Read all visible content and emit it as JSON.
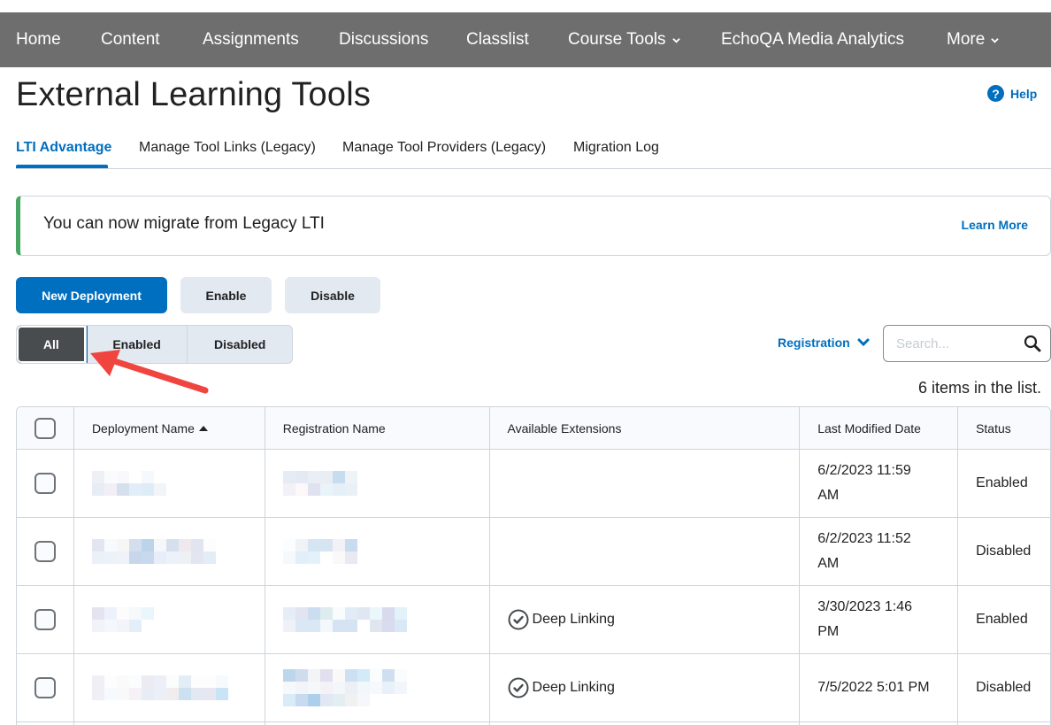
{
  "nav": {
    "items": [
      {
        "label": "Home",
        "dropdown": false
      },
      {
        "label": "Content",
        "dropdown": false
      },
      {
        "label": "Assignments",
        "dropdown": false
      },
      {
        "label": "Discussions",
        "dropdown": false
      },
      {
        "label": "Classlist",
        "dropdown": false
      },
      {
        "label": "Course Tools",
        "dropdown": true
      },
      {
        "label": "EchoQA Media Analytics",
        "dropdown": false
      },
      {
        "label": "More",
        "dropdown": true
      }
    ]
  },
  "page": {
    "title": "External Learning Tools",
    "help_label": "Help",
    "help_icon": "?"
  },
  "tabs": [
    {
      "label": "LTI Advantage",
      "active": true
    },
    {
      "label": "Manage Tool Links (Legacy)",
      "active": false
    },
    {
      "label": "Manage Tool Providers (Legacy)",
      "active": false
    },
    {
      "label": "Migration Log",
      "active": false
    }
  ],
  "alert": {
    "message": "You can now migrate from Legacy LTI",
    "link": "Learn More",
    "accent_color": "#46a661"
  },
  "actions": {
    "new_deployment": "New Deployment",
    "enable": "Enable",
    "disable": "Disable"
  },
  "filter": {
    "options": [
      "All",
      "Enabled",
      "Disabled"
    ],
    "selected": "All"
  },
  "registration_dropdown": "Registration",
  "search": {
    "placeholder": "Search...",
    "value": ""
  },
  "item_count": "6 items in the list.",
  "table": {
    "headers": {
      "deployment_name": "Deployment Name",
      "registration_name": "Registration Name",
      "available_extensions": "Available Extensions",
      "last_modified": "Last Modified Date",
      "status": "Status"
    },
    "sort": {
      "column": "deployment_name",
      "direction": "ascending"
    },
    "rows": [
      {
        "deployment_name": "[redacted]",
        "registration_name": "[redacted]",
        "extension": "",
        "last_modified": "6/2/2023 11:59\nAM",
        "status": "Enabled"
      },
      {
        "deployment_name": "[redacted]",
        "registration_name": "[redacted]",
        "extension": "",
        "last_modified": "6/2/2023 11:52\nAM",
        "status": "Disabled"
      },
      {
        "deployment_name": "[redacted]",
        "registration_name": "[redacted]",
        "extension": "Deep Linking",
        "last_modified": "3/30/2023 1:46\nPM",
        "status": "Enabled"
      },
      {
        "deployment_name": "[redacted]",
        "registration_name": "[redacted]",
        "extension": "Deep Linking",
        "last_modified": "7/5/2022 5:01 PM",
        "status": "Disabled"
      }
    ]
  },
  "colors": {
    "nav_bg": "#6e6e6e",
    "brand_blue": "#006fbf",
    "selected_filter_bg": "#494c4e",
    "secondary_btn_bg": "#e3e9f1",
    "annotation_arrow": "#f0453f"
  }
}
